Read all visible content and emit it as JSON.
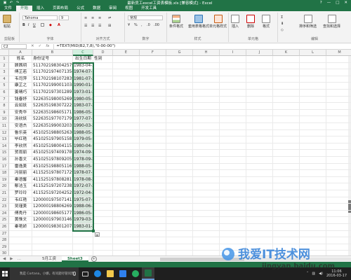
{
  "window": {
    "title": "最新员工excel工资表模板.xls [兼容模式] - Excel",
    "qa_icons": [
      "save-icon",
      "undo-icon",
      "redo-icon"
    ],
    "controls": [
      "?",
      "—",
      "□",
      "✕"
    ]
  },
  "menu": [
    "文件",
    "开始",
    "插入",
    "页面布局",
    "公式",
    "数据",
    "审阅",
    "视图",
    "开发工具"
  ],
  "ribbon": {
    "paste": "粘贴",
    "clipboard": "剪贴板",
    "font_name": "Tahoma",
    "font_size": "9",
    "font_group": "字体",
    "align_group": "对齐方式",
    "number_format": "常规",
    "number_group": "数字",
    "conditional": "条件格式",
    "table_format": "套用表格格式",
    "cell_styles": "单元格样式",
    "styles_group": "样式",
    "insert": "插入",
    "delete": "删除",
    "format": "格式",
    "cells_group": "单元格",
    "sort": "排序和筛选",
    "find": "查找和选择",
    "edit_group": "编辑"
  },
  "formula_bar": {
    "name_box": "C2",
    "formula": "=TEXT(MID(B2,7,8),\"0-00-00\")",
    "cancel": "✕",
    "enter": "✓",
    "fx": "fx"
  },
  "grid": {
    "columns": [
      "A",
      "B",
      "C",
      "D",
      "E",
      "F",
      "G",
      "H",
      "I",
      "J",
      "K",
      "L",
      "M",
      "N"
    ],
    "headers": [
      "姓名",
      "身份证号",
      "出生日期",
      "性别"
    ],
    "rows": [
      [
        "顾茜玥",
        "511702198304257904",
        "1983-04-25"
      ],
      [
        "傅芷若",
        "511702197407135024",
        "1974-07-13"
      ],
      [
        "韦司萍",
        "511702198107283986",
        "1981-07-28"
      ],
      [
        "康芷之",
        "511702199001103486",
        "1990-01-10"
      ],
      [
        "姜晴巧",
        "511702197301289703",
        "1973-01-28"
      ],
      [
        "钱春妤",
        "522635198005269942",
        "1980-05-26"
      ],
      [
        "云如妖",
        "522635198307222381",
        "1983-07-22"
      ],
      [
        "安秀华",
        "522635198605171586",
        "1986-05-17"
      ],
      [
        "汤欣妖",
        "522635197707179947",
        "1977-07-17"
      ],
      [
        "安语杰",
        "522635199003203143",
        "1990-03-20"
      ],
      [
        "鲁乐英",
        "451025198805263085",
        "1988-05-26"
      ],
      [
        "毕红艳",
        "451025197905158763",
        "1979-05-15"
      ],
      [
        "李欣然",
        "451025198004115125X",
        "1980-04-11"
      ],
      [
        "贺雨丽",
        "451025197409178941",
        "1974-09-17"
      ],
      [
        "孙香文",
        "451025197809205945",
        "1978-09-20"
      ],
      [
        "雷逸美",
        "451025198805116966",
        "1988-05-11"
      ],
      [
        "冯丽丽",
        "411525197807172924",
        "1978-07-17"
      ],
      [
        "秦语馨",
        "411525197808281145",
        "1978-08-28"
      ],
      [
        "鄢洁玉",
        "411525197207238221",
        "1972-07-23"
      ],
      [
        "罗玲玲",
        "411525197204252845",
        "1972-04-25"
      ],
      [
        "韦红艳",
        "120000197507141240",
        "1975-07-14"
      ],
      [
        "吴瑾美",
        "120000198806269580",
        "1988-06-26"
      ],
      [
        "傅秀丹",
        "120000198605177321",
        "1986-05-17"
      ],
      [
        "黄惟文",
        "120000197903146107",
        "1979-03-14"
      ],
      [
        "秦艳娇",
        "120000198301207800",
        "1983-01-20"
      ]
    ]
  },
  "sheets": {
    "tabs": [
      "5月工资",
      "Sheet3"
    ],
    "active": "Sheet3",
    "add": "+",
    "nav": [
      "◀",
      "▶",
      "…"
    ]
  },
  "taskbar": {
    "search_placeholder": "我是 Cortana，小娜。有问题尽管问我。",
    "time": "11:06",
    "date": "2016-03-17"
  },
  "watermark": {
    "text": "我爱IT技术网",
    "url": "jingyan.baidu.com"
  },
  "colors": {
    "excel_green": "#217346",
    "selection_fill": "#d9e7dd",
    "taskbar": "#1f1f1f"
  }
}
